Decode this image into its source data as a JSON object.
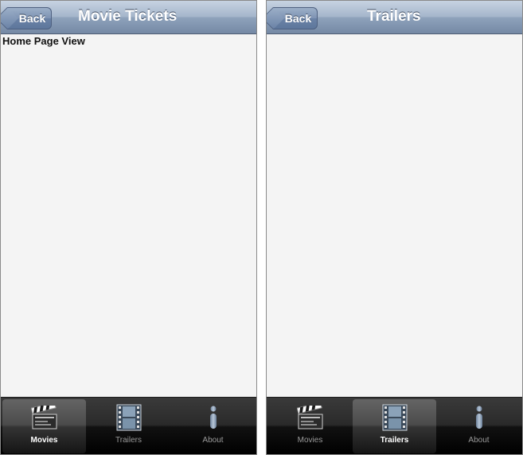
{
  "screens": [
    {
      "back_label": "Back",
      "title": "Movie Tickets",
      "content": "Home Page View",
      "tabs": [
        {
          "label": "Movies",
          "icon": "clapperboard-icon",
          "active": true
        },
        {
          "label": "Trailers",
          "icon": "film-strip-icon",
          "active": false
        },
        {
          "label": "About",
          "icon": "info-icon",
          "active": false
        }
      ]
    },
    {
      "back_label": "Back",
      "title": "Trailers",
      "content": "",
      "tabs": [
        {
          "label": "Movies",
          "icon": "clapperboard-icon",
          "active": false
        },
        {
          "label": "Trailers",
          "icon": "film-strip-icon",
          "active": true
        },
        {
          "label": "About",
          "icon": "info-icon",
          "active": false
        }
      ]
    }
  ],
  "colors": {
    "navbar": "#8ea2bb",
    "content_bg": "#f4f4f4",
    "tabbar": "#111111",
    "active_label": "#ffffff",
    "inactive_label": "#9a9a9a"
  }
}
